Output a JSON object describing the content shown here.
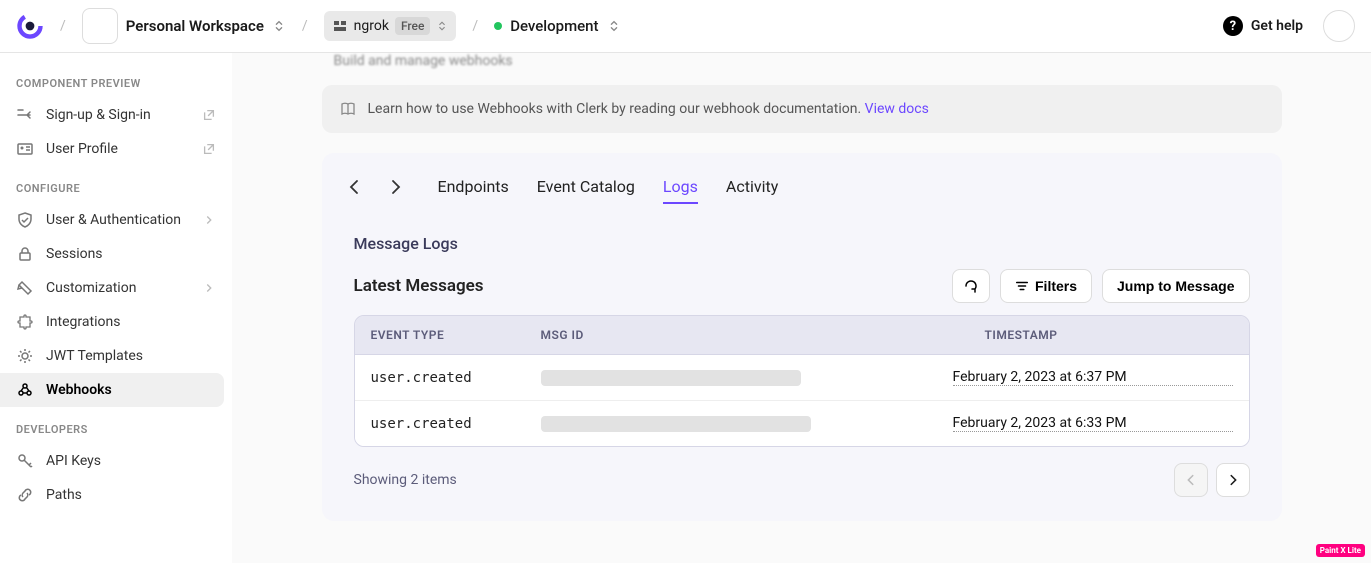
{
  "header": {
    "workspace": "Personal Workspace",
    "app_name": "ngrok",
    "plan_badge": "Free",
    "instance": "Development",
    "help_label": "Get help"
  },
  "page": {
    "subtitle_blur": "Build and manage webhooks"
  },
  "sidebar": {
    "section_preview": "COMPONENT PREVIEW",
    "section_configure": "CONFIGURE",
    "section_developers": "DEVELOPERS",
    "preview_items": [
      {
        "label": "Sign-up & Sign-in",
        "icon": "signin-icon",
        "ext": true
      },
      {
        "label": "User Profile",
        "icon": "profile-icon",
        "ext": true
      }
    ],
    "configure_items": [
      {
        "label": "User & Authentication",
        "icon": "shield-icon",
        "chev": true
      },
      {
        "label": "Sessions",
        "icon": "lock-icon"
      },
      {
        "label": "Customization",
        "icon": "palette-icon",
        "chev": true
      },
      {
        "label": "Integrations",
        "icon": "puzzle-icon"
      },
      {
        "label": "JWT Templates",
        "icon": "gear-icon"
      },
      {
        "label": "Webhooks",
        "icon": "webhook-icon",
        "active": true
      }
    ],
    "developer_items": [
      {
        "label": "API Keys",
        "icon": "key-icon"
      },
      {
        "label": "Paths",
        "icon": "link-icon"
      }
    ]
  },
  "banner": {
    "text": "Learn how to use Webhooks with Clerk by reading our webhook documentation. ",
    "link": "View docs"
  },
  "tabs": {
    "items": [
      "Endpoints",
      "Event Catalog",
      "Logs",
      "Activity"
    ],
    "active": "Logs"
  },
  "logs": {
    "section_title": "Message Logs",
    "latest_title": "Latest Messages",
    "filters_btn": "Filters",
    "jump_btn": "Jump to Message",
    "columns": {
      "event": "EVENT TYPE",
      "msg": "MSG ID",
      "ts": "TIMESTAMP"
    },
    "rows": [
      {
        "event": "user.created",
        "timestamp": "February 2, 2023 at 6:37 PM"
      },
      {
        "event": "user.created",
        "timestamp": "February 2, 2023 at 6:33 PM"
      }
    ],
    "pager_info": "Showing 2 items"
  },
  "corner_badge": "Paint X Lite"
}
